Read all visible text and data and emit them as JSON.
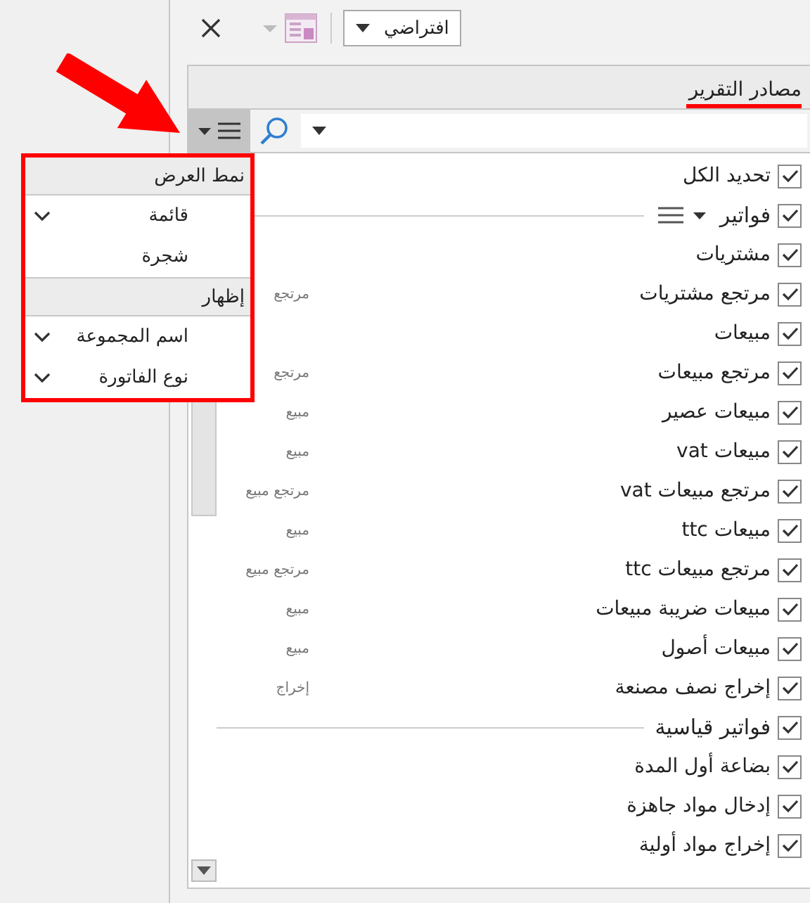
{
  "toolbar": {
    "layout_dropdown": {
      "value": "افتراضي"
    }
  },
  "panel": {
    "title": "مصادر التقرير"
  },
  "items": [
    {
      "kind": "all",
      "label": "تحديد الكل",
      "checked": true
    },
    {
      "kind": "group",
      "label": "فواتير",
      "checked": true,
      "menu_button": true
    },
    {
      "kind": "item",
      "label": "مشتريات",
      "checked": true
    },
    {
      "kind": "item",
      "label": "مرتجع مشتريات",
      "checked": true,
      "sub": "مرتجع"
    },
    {
      "kind": "item",
      "label": "مبيعات",
      "checked": true
    },
    {
      "kind": "item",
      "label": "مرتجع مبيعات",
      "checked": true,
      "sub": "مرتجع"
    },
    {
      "kind": "item",
      "label": "مبيعات عصير",
      "checked": true,
      "sub": "مبيع"
    },
    {
      "kind": "item",
      "label": "مبيعات vat",
      "checked": true,
      "sub": "مبيع"
    },
    {
      "kind": "item",
      "label": "مرتجع مبيعات vat",
      "checked": true,
      "sub": "مرتجع مبيع"
    },
    {
      "kind": "item",
      "label": "مبيعات ttc",
      "checked": true,
      "sub": "مبيع"
    },
    {
      "kind": "item",
      "label": "مرتجع مبيعات ttc",
      "checked": true,
      "sub": "مرتجع مبيع"
    },
    {
      "kind": "item",
      "label": "مبيعات ضريبة مبيعات",
      "checked": true,
      "sub": "مبيع"
    },
    {
      "kind": "item",
      "label": "مبيعات أصول",
      "checked": true,
      "sub": "مبيع"
    },
    {
      "kind": "item",
      "label": "إخراج نصف مصنعة",
      "checked": true,
      "sub": "إخراج"
    },
    {
      "kind": "group",
      "label": "فواتير قياسية",
      "checked": true,
      "menu_button": false
    },
    {
      "kind": "item",
      "label": "بضاعة أول المدة",
      "checked": true
    },
    {
      "kind": "item",
      "label": "إدخال مواد جاهزة",
      "checked": true
    },
    {
      "kind": "item",
      "label": "إخراج مواد أولية",
      "checked": true
    }
  ],
  "menu": {
    "sections": [
      {
        "title": "نمط العرض",
        "options": [
          {
            "label": "قائمة",
            "checked": true
          },
          {
            "label": "شجرة",
            "checked": false
          }
        ]
      },
      {
        "title": "إظهار",
        "options": [
          {
            "label": "اسم المجموعة",
            "checked": true
          },
          {
            "label": "نوع الفاتورة",
            "checked": true
          }
        ]
      }
    ]
  }
}
